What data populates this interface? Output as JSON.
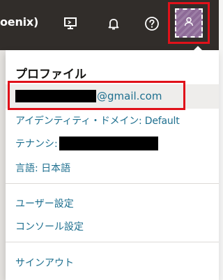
{
  "header": {
    "region_label": "oenix)",
    "icons": [
      {
        "name": "cloud-shell-icon"
      },
      {
        "name": "notifications-bell-icon"
      },
      {
        "name": "help-icon"
      },
      {
        "name": "user-profile-icon"
      }
    ]
  },
  "profile_menu": {
    "title": "プロファイル",
    "email_suffix": "@gmail.com",
    "identity_domain": "アイデンティティ・ドメイン: Default",
    "tenancy_label": "テナンシ:",
    "language": "言語: 日本語",
    "links": {
      "user_settings": "ユーザー設定",
      "console_settings": "コンソール設定",
      "sign_out": "サインアウト"
    }
  },
  "colors": {
    "header_bg": "#312d2a",
    "link": "#1e6f8f",
    "highlight": "#e0111a",
    "avatar_bg": "#8d6a97"
  }
}
